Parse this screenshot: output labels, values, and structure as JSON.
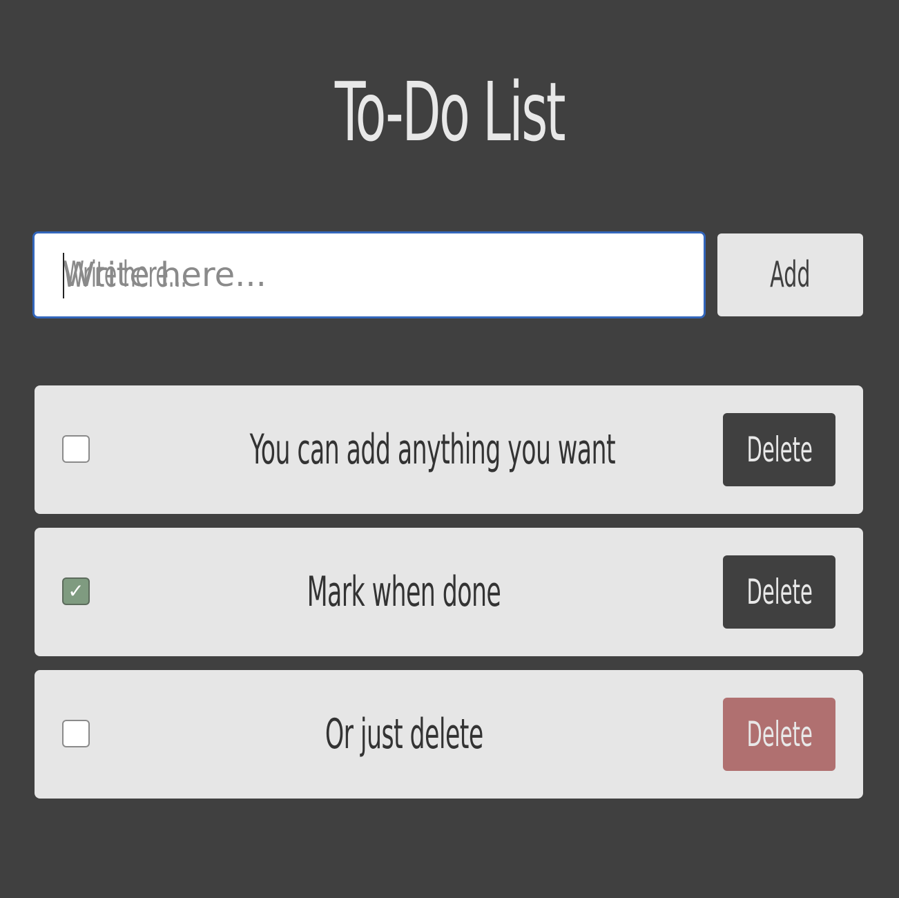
{
  "app": {
    "title": "To-Do List"
  },
  "input": {
    "placeholder": "Write here...",
    "value": ""
  },
  "add_button": {
    "label": "Add"
  },
  "todos": [
    {
      "text": "You can add anything you want",
      "checked": false,
      "delete_label": "Delete"
    },
    {
      "text": "Mark when done",
      "checked": true,
      "delete_label": "Delete"
    },
    {
      "text": "Or just delete",
      "checked": false,
      "delete_label": "Delete",
      "delete_hover": true
    }
  ],
  "colors": {
    "background": "#404040",
    "card": "#e6e6e6",
    "input_focus_border": "#3366bb",
    "checkbox_checked": "#7f9b80",
    "delete_button": "#404040",
    "delete_button_hover": "#b07070"
  },
  "icons": {
    "checkmark": "checkmark-icon"
  }
}
